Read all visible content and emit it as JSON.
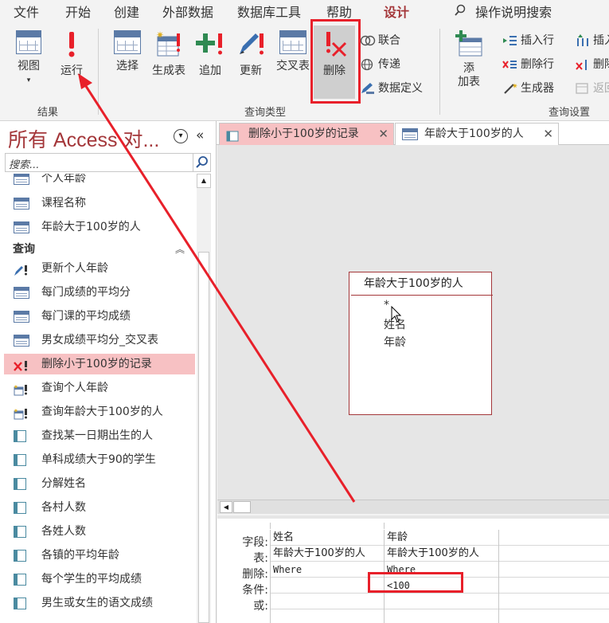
{
  "menu": {
    "items": [
      "文件",
      "开始",
      "创建",
      "外部数据",
      "数据库工具",
      "帮助",
      "设计"
    ],
    "active": "设计",
    "search_label": "操作说明搜索"
  },
  "ribbon": {
    "results_group": {
      "label": "结果",
      "view": "视图",
      "run": "运行"
    },
    "query_type_group": {
      "label": "查询类型",
      "select": "选择",
      "make_table": "生成表",
      "append": "追加",
      "update": "更新",
      "crosstab": "交叉表",
      "delete": "删除",
      "union": "联合",
      "pass_through": "传递",
      "data_definition": "数据定义"
    },
    "query_setup_group": {
      "label": "查询设置",
      "show_table_line1": "添",
      "show_table_line2": "加表",
      "insert_rows": "插入行",
      "delete_rows": "删除行",
      "builder": "生成器",
      "insert_columns_partial": "插入",
      "delete_columns_partial": "删除",
      "return_partial": "返回"
    }
  },
  "nav": {
    "title": "所有 Access 对...",
    "search_placeholder": "搜索...",
    "tables": [
      "个人年龄",
      "课程名称",
      "年龄大于100岁的人"
    ],
    "queries_section": "查询",
    "queries": [
      {
        "label": "更新个人年龄",
        "icon": "update-query-icon"
      },
      {
        "label": "每门成绩的平均分",
        "icon": "crosstab-query-icon"
      },
      {
        "label": "每门课的平均成绩",
        "icon": "crosstab-query-icon"
      },
      {
        "label": "男女成绩平均分_交叉表",
        "icon": "crosstab-query-icon"
      },
      {
        "label": "删除小于100岁的记录",
        "icon": "delete-query-icon"
      },
      {
        "label": "查询个人年龄",
        "icon": "make-table-query-icon"
      },
      {
        "label": "查询年龄大于100岁的人",
        "icon": "make-table-query-icon"
      },
      {
        "label": "查找某一日期出生的人",
        "icon": "select-query-icon"
      },
      {
        "label": "单科成绩大于90的学生",
        "icon": "select-query-icon"
      },
      {
        "label": "分解姓名",
        "icon": "select-query-icon"
      },
      {
        "label": "各村人数",
        "icon": "select-query-icon"
      },
      {
        "label": "各姓人数",
        "icon": "select-query-icon"
      },
      {
        "label": "各镇的平均年龄",
        "icon": "select-query-icon"
      },
      {
        "label": "每个学生的平均成绩",
        "icon": "select-query-icon"
      },
      {
        "label": "男生或女生的语文成绩",
        "icon": "select-query-icon"
      }
    ]
  },
  "tabs": [
    {
      "label": "删除小于100岁的记录",
      "active": true
    },
    {
      "label": "年龄大于100岁的人",
      "active": false
    }
  ],
  "field_list": {
    "title": "年龄大于100岁的人",
    "fields": [
      "*",
      "姓名",
      "年龄"
    ]
  },
  "qbe": {
    "row_labels": [
      "字段:",
      "表:",
      "删除:",
      "条件:",
      "或:"
    ],
    "columns": [
      {
        "field": "姓名",
        "table": "年龄大于100岁的人",
        "delete": "Where",
        "criteria": "",
        "or": ""
      },
      {
        "field": "年龄",
        "table": "年龄大于100岁的人",
        "delete": "Where",
        "criteria": "<100",
        "or": ""
      }
    ]
  },
  "colors": {
    "accent": "#a4373a",
    "highlight": "#f7c1c3",
    "annotation": "#e8202a"
  }
}
